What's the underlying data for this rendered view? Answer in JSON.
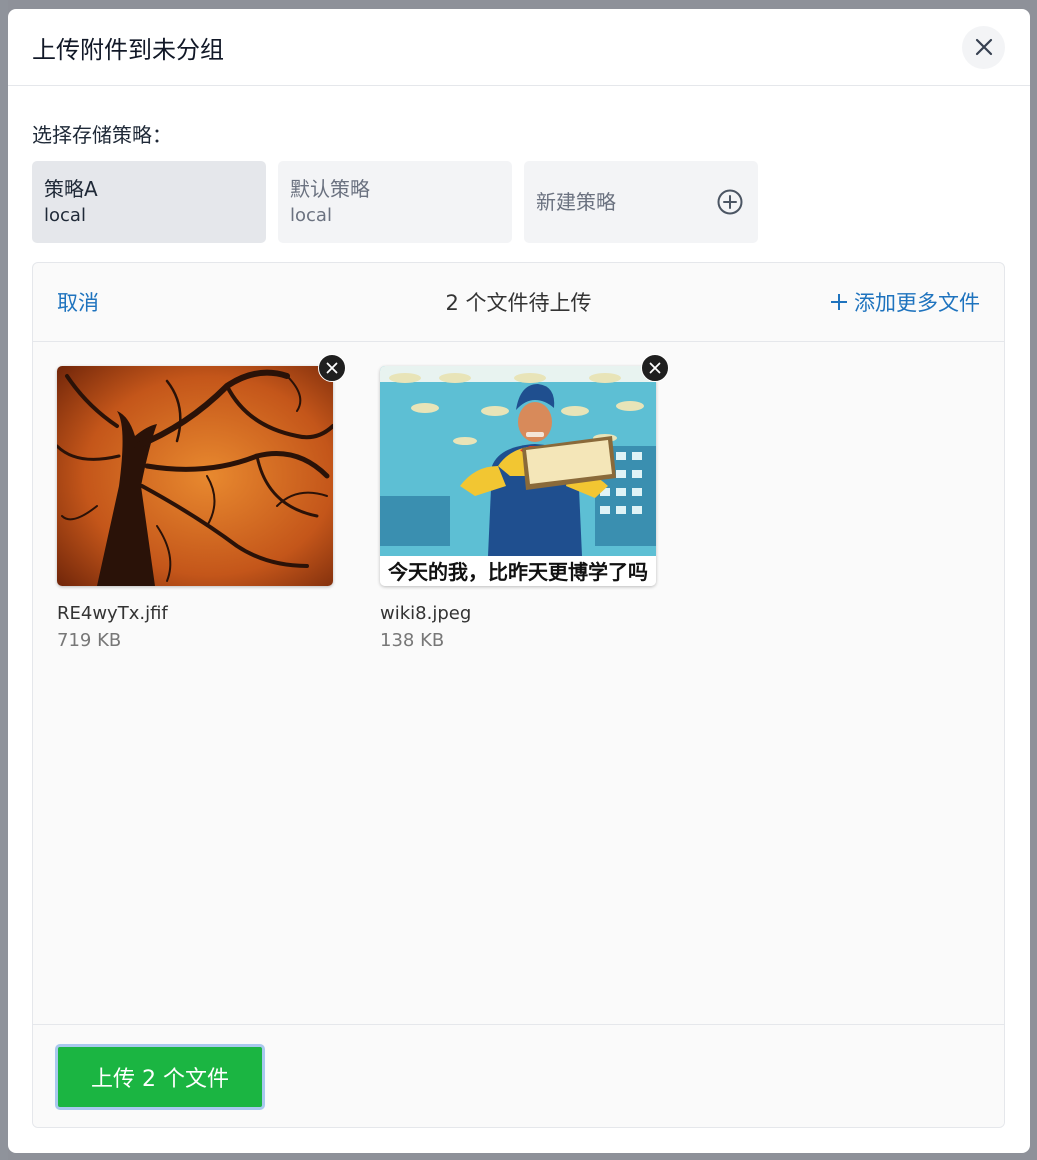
{
  "modal": {
    "title": "上传附件到未分组"
  },
  "storage": {
    "label": "选择存储策略：",
    "policies": [
      {
        "name": "策略A",
        "type": "local",
        "selected": true
      },
      {
        "name": "默认策略",
        "type": "local",
        "selected": false
      }
    ],
    "new_policy_label": "新建策略"
  },
  "uploader": {
    "cancel_label": "取消",
    "status": "2 个文件待上传",
    "add_more_label": "添加更多文件",
    "files": [
      {
        "name": "RE4wyTx.jfif",
        "size": "719 KB"
      },
      {
        "name": "wiki8.jpeg",
        "size": "138 KB",
        "caption": "今天的我，比昨天更博学了吗"
      }
    ],
    "upload_button_label": "上传 2 个文件"
  },
  "icons": {
    "close": "close-icon",
    "add_circle": "plus-circle-icon",
    "plus": "plus-icon",
    "remove": "remove-file-icon"
  },
  "colors": {
    "accent_link": "#1e73be",
    "upload_button": "#1bb542"
  }
}
